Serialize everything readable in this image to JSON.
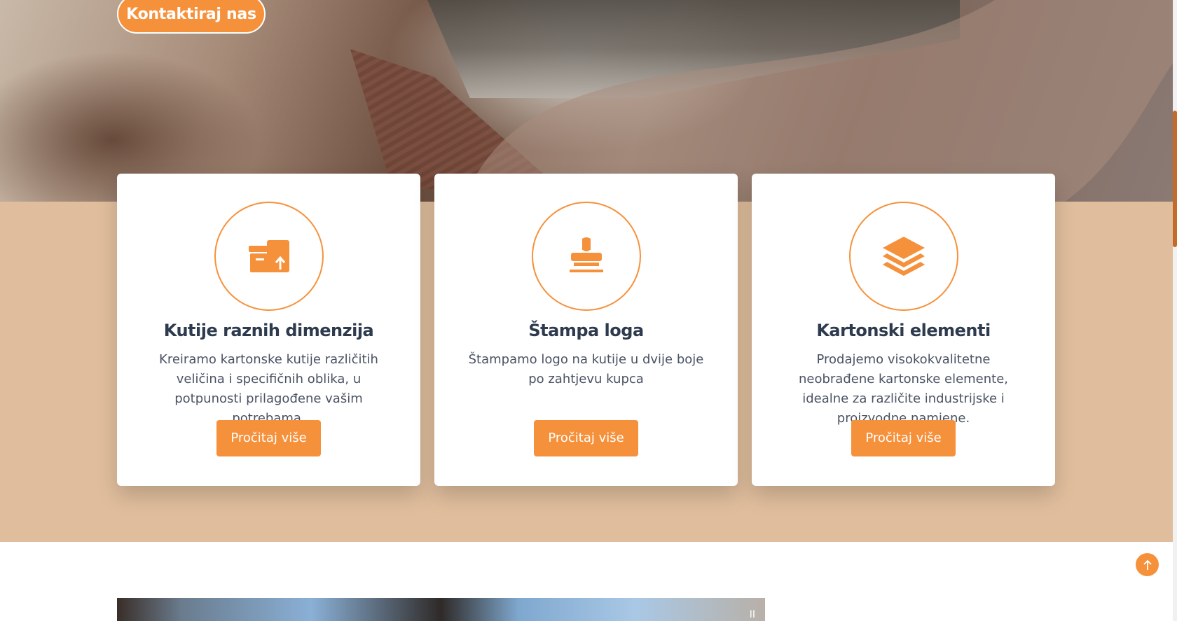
{
  "hero": {
    "contact_button": "Kontaktiraj nas"
  },
  "services": [
    {
      "icon": "box-upload-icon",
      "title": "Kutije raznih dimenzija",
      "description": "Kreiramo kartonske kutije različitih veličina i specifičnih oblika, u potpunosti prilagođene vašim potrebama.",
      "button": "Pročitaj više"
    },
    {
      "icon": "stamp-icon",
      "title": "Štampa loga",
      "description": "Štampamo logo na kutije u dvije boje po zahtjevu kupca",
      "button": "Pročitaj više"
    },
    {
      "icon": "layers-icon",
      "title": "Kartonski elementi",
      "description": "Prodajemo visokokvalitetne neobrađene kartonske elemente, idealne za različite industrijske i proizvodne namjene.",
      "button": "Pročitaj više"
    }
  ],
  "video": {
    "pause_label": "II"
  },
  "colors": {
    "accent": "#f6913b",
    "band": "#e0be9d",
    "heading": "#2e3a4d"
  }
}
